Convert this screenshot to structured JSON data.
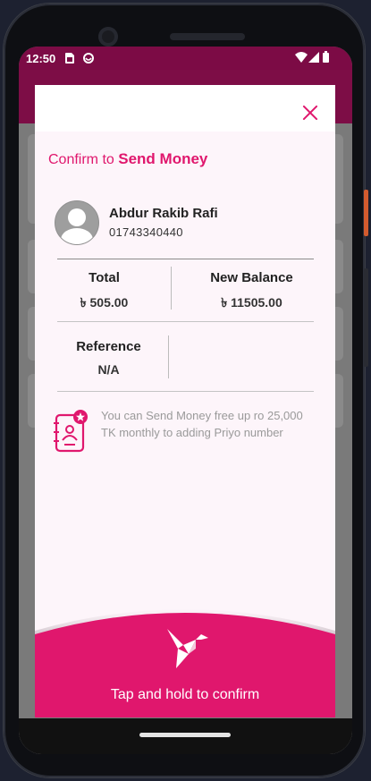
{
  "status_bar": {
    "time": "12:50"
  },
  "dialog": {
    "title_prefix": "Confirm to",
    "title_action": "Send Money"
  },
  "recipient": {
    "name": "Abdur Rakib Rafi",
    "phone": "01743340440"
  },
  "summary": {
    "total_label": "Total",
    "total_value": "৳ 505.00",
    "new_balance_label": "New Balance",
    "new_balance_value": "৳ 11505.00",
    "reference_label": "Reference",
    "reference_value": "N/A"
  },
  "info_text": "You can Send Money free up ro 25,000 TK monthly to adding Priyo number",
  "confirm": {
    "label": "Tap and hold to confirm"
  },
  "colors": {
    "accent": "#e0176d",
    "app_bar": "#7c0b45",
    "dialog_bg": "#fdf5fa",
    "overlay": "#7a7a7a"
  },
  "icons": {
    "close": "close-icon",
    "avatar": "user-avatar-icon",
    "contact": "contact-book-star-icon",
    "confirm": "paper-bird-icon",
    "wifi": "wifi-icon",
    "signal": "signal-icon",
    "battery": "battery-icon"
  }
}
